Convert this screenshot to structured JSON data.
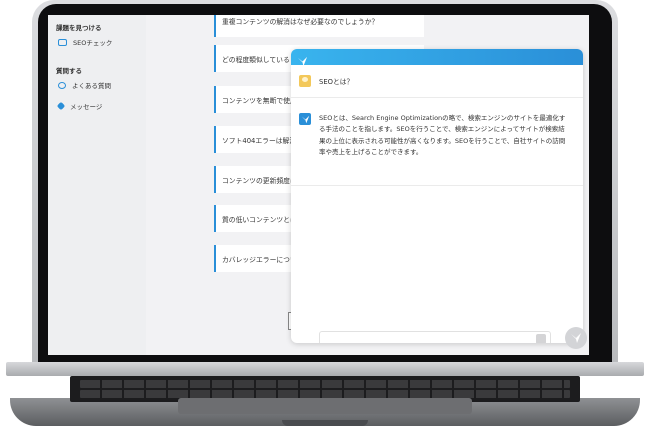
{
  "sidebar": {
    "section1": "課題を見つける",
    "item_seo_check": "SEOチェック",
    "section2": "質問する",
    "item_faq": "よくある質問",
    "item_message": "メッセージ"
  },
  "main": {
    "questions": [
      "重複コンテンツの解消はなぜ必要なのでしょうか？",
      "どの程度類似しているとう",
      "コンテンツを無断で使用",
      "ソフト404エラーは解決",
      "コンテンツの更新頻度は",
      "質の低いコンテンツとは",
      "カバレッジエラーについ"
    ]
  },
  "chat": {
    "user_question": "SEOとは？",
    "bot_answer": "SEOとは、Search Engine Optimizationの略で、検索エンジンのサイトを最適化する手法のことを指します。SEOを行うことで、検索エンジンによってサイトが検索結果の上位に表示される可能性が高くなります。SEOを行うことで、自社サイトの訪問率や売上を上げることができます。",
    "input_value": ""
  },
  "colors": {
    "accent": "#2a8fd8",
    "header_gradient_start": "#39b4ee"
  }
}
